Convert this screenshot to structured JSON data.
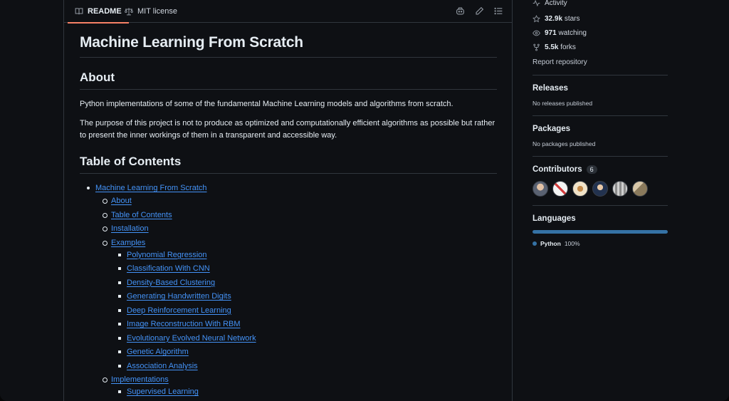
{
  "readme_header": {
    "readme_tab": "README",
    "license_tab": "MIT license"
  },
  "readme": {
    "title": "Machine Learning From Scratch",
    "about_heading": "About",
    "about_text": "Python implementations of some of the fundamental Machine Learning models and algorithms from scratch.",
    "purpose_text": "The purpose of this project is not to produce as optimized and computationally efficient algorithms as possible but rather to present the inner workings of them in a transparent and accessible way.",
    "toc_heading": "Table of Contents",
    "toc": {
      "root": "Machine Learning From Scratch",
      "about": "About",
      "table_of_contents": "Table of Contents",
      "installation": "Installation",
      "examples": "Examples",
      "example_items": [
        "Polynomial Regression",
        "Classification With CNN",
        "Density-Based Clustering",
        "Generating Handwritten Digits",
        "Deep Reinforcement Learning",
        "Image Reconstruction With RBM",
        "Evolutionary Evolved Neural Network",
        "Genetic Algorithm",
        "Association Analysis"
      ],
      "implementations": "Implementations",
      "implementation_items": [
        "Supervised Learning"
      ]
    }
  },
  "sidebar": {
    "activity": "Activity",
    "stars_count": "32.9k",
    "stars_label": "stars",
    "watching_count": "971",
    "watching_label": "watching",
    "forks_count": "5.5k",
    "forks_label": "forks",
    "report": "Report repository",
    "releases_heading": "Releases",
    "releases_text": "No releases published",
    "packages_heading": "Packages",
    "packages_text": "No packages published",
    "contributors_heading": "Contributors",
    "contributors_count": "6",
    "languages_heading": "Languages",
    "language_name": "Python",
    "language_percent": "100%",
    "python_color": "#3572a5"
  }
}
